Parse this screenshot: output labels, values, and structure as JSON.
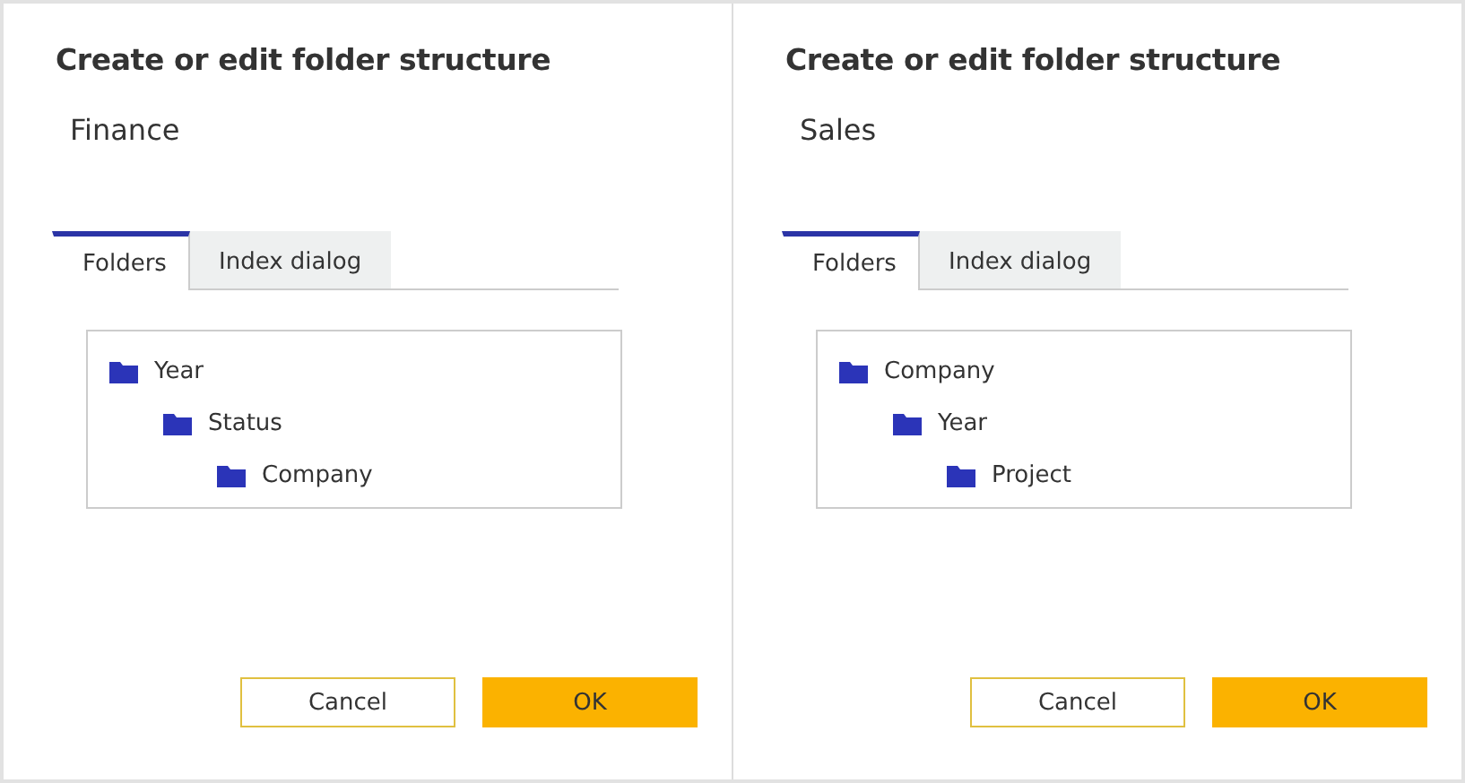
{
  "dialogs": [
    {
      "title": "Create or edit folder structure",
      "name": "Finance",
      "tabs": [
        {
          "label": "Folders",
          "selected": true
        },
        {
          "label": "Index dialog",
          "selected": false
        }
      ],
      "folders": [
        {
          "label": "Year",
          "children": [
            {
              "label": "Status",
              "children": [
                {
                  "label": "Company"
                }
              ]
            }
          ]
        }
      ],
      "buttons": [
        {
          "label": "Cancel",
          "kind": "secondary"
        },
        {
          "label": "OK",
          "kind": "primary"
        }
      ]
    },
    {
      "title": "Create or edit folder structure",
      "name": "Sales",
      "tabs": [
        {
          "label": "Folders",
          "selected": true
        },
        {
          "label": "Index dialog",
          "selected": false
        }
      ],
      "folders": [
        {
          "label": "Company",
          "children": [
            {
              "label": "Year",
              "children": [
                {
                  "label": "Project"
                }
              ]
            }
          ]
        }
      ],
      "buttons": [
        {
          "label": "Cancel",
          "kind": "secondary"
        },
        {
          "label": "OK",
          "kind": "primary"
        }
      ]
    }
  ]
}
